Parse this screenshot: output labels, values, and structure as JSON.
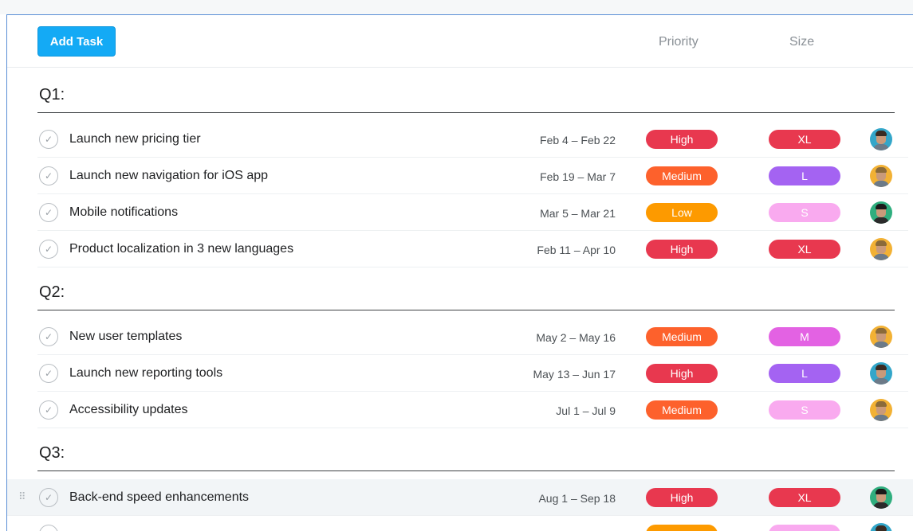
{
  "header": {
    "add_task_label": "Add Task",
    "priority_label": "Priority",
    "size_label": "Size"
  },
  "colors": {
    "accent": "#14aaf5",
    "high": "#e8384f",
    "medium": "#fd612c",
    "low": "#fd9a00",
    "size_xl": "#e8384f",
    "size_l": "#a463f2",
    "size_m": "#e362e3",
    "size_s": "#f9aaef"
  },
  "sections": [
    {
      "title": "Q1:",
      "tasks": [
        {
          "name": "Launch new pricing tier",
          "dates": "Feb 4 – Feb 22",
          "priority": "High",
          "size": "XL"
        },
        {
          "name": "Launch new navigation for iOS app",
          "dates": "Feb 19 – Mar 7",
          "priority": "Medium",
          "size": "L"
        },
        {
          "name": "Mobile notifications",
          "dates": "Mar 5 – Mar 21",
          "priority": "Low",
          "size": "S"
        },
        {
          "name": "Product localization in 3 new languages",
          "dates": "Feb 11 – Apr 10",
          "priority": "High",
          "size": "XL"
        }
      ]
    },
    {
      "title": "Q2:",
      "tasks": [
        {
          "name": "New user templates",
          "dates": "May 2 – May 16",
          "priority": "Medium",
          "size": "M"
        },
        {
          "name": "Launch new reporting tools",
          "dates": "May 13 – Jun 17",
          "priority": "High",
          "size": "L"
        },
        {
          "name": "Accessibility updates",
          "dates": "Jul 1 – Jul 9",
          "priority": "Medium",
          "size": "S"
        }
      ]
    },
    {
      "title": "Q3:",
      "tasks": [
        {
          "name": "Back-end speed enhancements",
          "dates": "Aug 1 – Sep 18",
          "priority": "High",
          "size": "XL"
        }
      ]
    }
  ]
}
